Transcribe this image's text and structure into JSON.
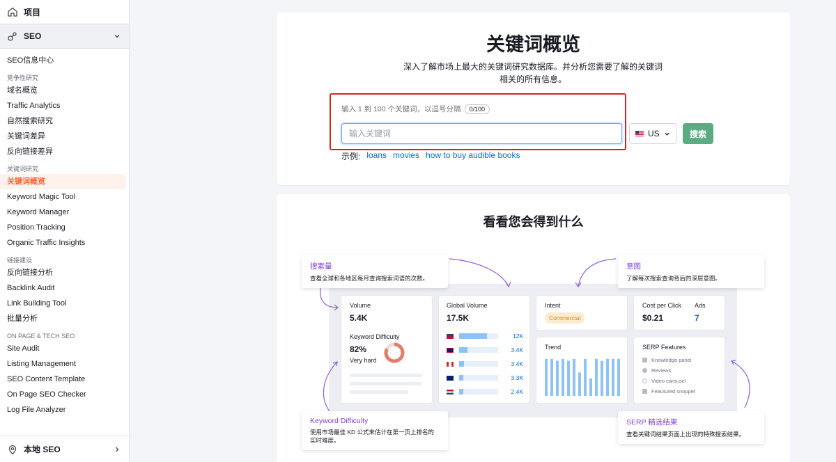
{
  "sidebar": {
    "projects_label": "项目",
    "seo_label": "SEO",
    "items_top": [
      "SEO信息中心"
    ],
    "groups": [
      {
        "title": "竞争性研究",
        "items": [
          "域名概览",
          "Traffic Analytics",
          "自然搜索研究",
          "关键词差异",
          "反向链接差异"
        ]
      },
      {
        "title": "关键词研究",
        "items": [
          "关键词概览",
          "Keyword Magic Tool",
          "Keyword Manager",
          "Position Tracking",
          "Organic Traffic Insights"
        ]
      },
      {
        "title": "链接建设",
        "items": [
          "反向链接分析",
          "Backlink Audit",
          "Link Building Tool",
          "批量分析"
        ]
      },
      {
        "title": "ON PAGE & TECH SEO",
        "items": [
          "Site Audit",
          "Listing Management",
          "SEO Content Template",
          "On Page SEO Checker",
          "Log File Analyzer"
        ]
      }
    ],
    "active_item": "关键词概览",
    "local_seo_label": "本地 SEO"
  },
  "hero": {
    "title": "关键词概览",
    "subtitle": "深入了解市场上最大的关键词研究数据库。并分析您需要了解的关键词相关的所有信息。",
    "hint": "输入 1 到 100 个关键词，以逗号分隔",
    "counter": "0/100",
    "input_placeholder": "输入关键词",
    "country": "US",
    "search_button": "搜索",
    "examples_label": "示例:",
    "examples": [
      "loans",
      "movies",
      "how to buy audible books"
    ]
  },
  "preview": {
    "title": "看看您会得到什么",
    "volume_label": "Volume",
    "volume_value": "5.4K",
    "kd_label": "Keyword Difficulty",
    "kd_value": "82%",
    "kd_text": "Very hard",
    "kd_fraction": 0.82,
    "global_label": "Global Volume",
    "global_value": "17.5K",
    "global_rows": [
      {
        "flag": "us-flag",
        "value": "12K",
        "fill": 0.72
      },
      {
        "flag": "uk-flag",
        "value": "3.4K",
        "fill": 0.22
      },
      {
        "flag": "ca-flag",
        "value": "3.4K",
        "fill": 0.12
      },
      {
        "flag": "au-flag",
        "value": "3.3K",
        "fill": 0.1
      },
      {
        "flag": "nl-flag",
        "value": "2.4K",
        "fill": 0.1
      }
    ],
    "intent_label": "Intent",
    "intent_value": "Commercial",
    "cpc_label": "Cost per Click",
    "cpc_value": "$0.21",
    "ads_label": "Ads",
    "ads_value": "7",
    "trend_label": "Trend",
    "trend_values": [
      0.95,
      0.95,
      0.9,
      0.95,
      0.9,
      0.95,
      0.6,
      0.95,
      0.45,
      0.95,
      0.9,
      0.95,
      0.95,
      0.95
    ],
    "serp_label": "SERP Features",
    "serp_items": [
      "Knowledge panel",
      "Reviews",
      "Video carousel",
      "Feautured snoppet"
    ],
    "callouts": {
      "volume": {
        "title": "搜索量",
        "desc": "查看全球和各地区每月查询搜索词语的次数。"
      },
      "intent": {
        "title": "意图",
        "desc": "了解每次搜索查询背后的深层意图。"
      },
      "kd": {
        "title": "Keyword Difficulty",
        "desc": "使用市场最佳 KD 公式来估计在第一页上排名的实时难度。"
      },
      "serp": {
        "title": "SERP 精选结果",
        "desc": "查看关键词结果页面上出现的特殊搜索结果。"
      }
    }
  },
  "colors": {
    "accent": "#ff642d",
    "search_button": "#5cac83",
    "link": "#006dca",
    "callout_title": "#7f40d0",
    "highlight_box": "#d1261f"
  }
}
